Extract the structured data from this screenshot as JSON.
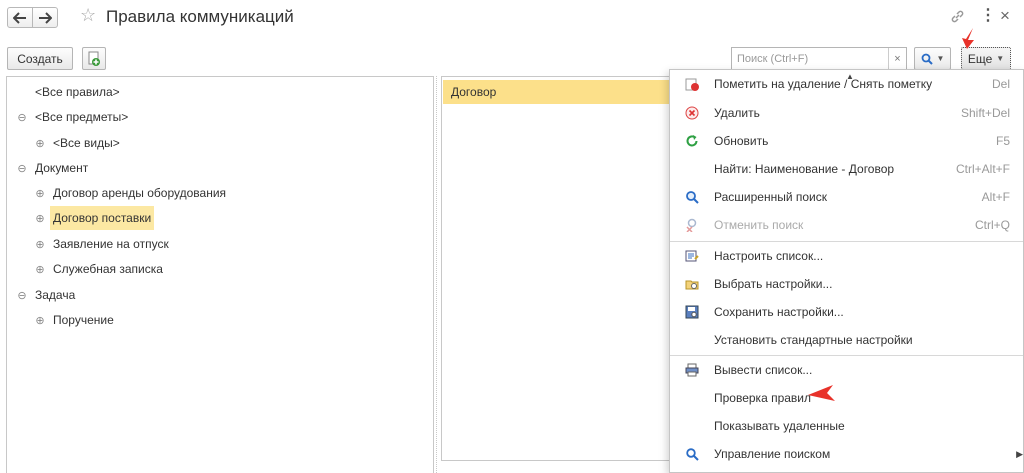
{
  "window": {
    "title": "Правила коммуникаций",
    "back_icon": "arrow-left-icon",
    "forward_icon": "arrow-right-icon",
    "favorite_icon": "star-icon",
    "link_icon": "link-icon",
    "menu_icon": "more-vertical-icon",
    "close_icon": "close-icon"
  },
  "toolbar": {
    "create_label": "Создать",
    "copy_icon": "copy-document-icon",
    "search_placeholder": "Поиск (Ctrl+F)",
    "search_clear": "×",
    "find_icon": "search-icon",
    "more_label": "Еще"
  },
  "tree": {
    "items": [
      {
        "label": "<Все правила>",
        "toggle": "",
        "selected": false
      },
      {
        "label": "<Все предметы>",
        "toggle": "⊖",
        "selected": false
      },
      {
        "label": "<Все виды>",
        "toggle": "⊕",
        "selected": false
      },
      {
        "label": "Документ",
        "toggle": "⊖",
        "selected": false
      },
      {
        "label": "Договор аренды оборудования",
        "toggle": "⊕",
        "selected": false
      },
      {
        "label": "Договор поставки",
        "toggle": "⊕",
        "selected": true
      },
      {
        "label": "Заявление на отпуск",
        "toggle": "⊕",
        "selected": false
      },
      {
        "label": "Служебная записка",
        "toggle": "⊕",
        "selected": false
      },
      {
        "label": "Задача",
        "toggle": "⊖",
        "selected": false
      },
      {
        "label": "Поручение",
        "toggle": "⊕",
        "selected": false
      }
    ]
  },
  "list": {
    "rows": [
      "Договор"
    ]
  },
  "menu": {
    "items": [
      {
        "label": "Пометить на удаление / Снять пометку",
        "shortcut": "Del",
        "icon": "mark-delete-icon",
        "disabled": false
      },
      {
        "label": "Удалить",
        "shortcut": "Shift+Del",
        "icon": "delete-icon",
        "disabled": false
      },
      {
        "label": "Обновить",
        "shortcut": "F5",
        "icon": "refresh-icon",
        "disabled": false
      },
      {
        "label": "Найти: Наименование - Договор",
        "shortcut": "Ctrl+Alt+F",
        "icon": "",
        "disabled": false
      },
      {
        "label": "Расширенный поиск",
        "shortcut": "Alt+F",
        "icon": "advanced-search-icon",
        "disabled": false
      },
      {
        "label": "Отменить поиск",
        "shortcut": "Ctrl+Q",
        "icon": "cancel-search-icon",
        "disabled": true
      },
      {
        "label": "Настроить список...",
        "shortcut": "",
        "icon": "list-settings-icon",
        "disabled": false
      },
      {
        "label": "Выбрать настройки...",
        "shortcut": "",
        "icon": "open-settings-icon",
        "disabled": false
      },
      {
        "label": "Сохранить настройки...",
        "shortcut": "",
        "icon": "save-settings-icon",
        "disabled": false
      },
      {
        "label": "Установить стандартные настройки",
        "shortcut": "",
        "icon": "",
        "disabled": false
      },
      {
        "label": "Вывести список...",
        "shortcut": "",
        "icon": "print-list-icon",
        "disabled": false
      },
      {
        "label": "Проверка правил",
        "shortcut": "",
        "icon": "",
        "disabled": false
      },
      {
        "label": "Показывать удаленные",
        "shortcut": "",
        "icon": "",
        "disabled": false
      },
      {
        "label": "Управление поиском",
        "shortcut": "",
        "icon": "search-icon",
        "disabled": false,
        "submenu": true
      }
    ]
  },
  "colors": {
    "selection": "#fce8a3",
    "list_selection": "#fce08a",
    "annotation_arrow": "#e8322a"
  }
}
